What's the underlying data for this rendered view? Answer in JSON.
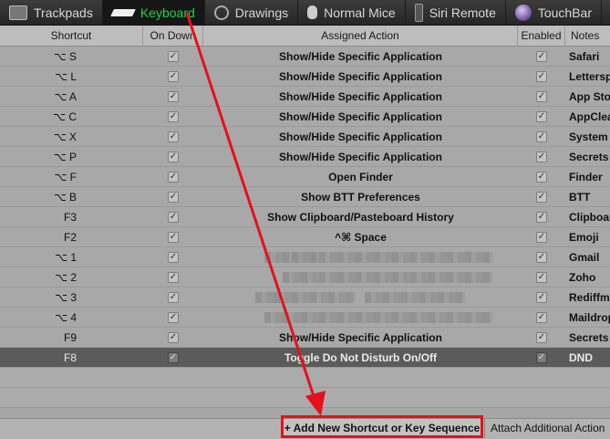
{
  "tabs": [
    {
      "label": "Trackpads",
      "icon": "trackpad-icon",
      "active": false
    },
    {
      "label": "Keyboard",
      "icon": "keyboard-icon",
      "active": true
    },
    {
      "label": "Drawings",
      "icon": "drawings-icon",
      "active": false
    },
    {
      "label": "Normal Mice",
      "icon": "mouse-icon",
      "active": false
    },
    {
      "label": "Siri Remote",
      "icon": "remote-icon",
      "active": false
    },
    {
      "label": "TouchBar",
      "icon": "touchbar-icon",
      "active": false
    }
  ],
  "columns": {
    "shortcut": "Shortcut",
    "ondown": "On Down",
    "action": "Assigned Action",
    "enabled": "Enabled",
    "notes": "Notes"
  },
  "rows": [
    {
      "shortcut": "⌥ S",
      "action": "Show/Hide Specific Application",
      "notes": "Safari"
    },
    {
      "shortcut": "⌥ L",
      "action": "Show/Hide Specific Application",
      "notes": "Letterspa"
    },
    {
      "shortcut": "⌥ A",
      "action": "Show/Hide Specific Application",
      "notes": "App Store"
    },
    {
      "shortcut": "⌥ C",
      "action": "Show/Hide Specific Application",
      "notes": "AppCleane"
    },
    {
      "shortcut": "⌥ X",
      "action": "Show/Hide Specific Application",
      "notes": "System"
    },
    {
      "shortcut": "⌥ P",
      "action": "Show/Hide Specific Application",
      "notes": "Secrets"
    },
    {
      "shortcut": "⌥ F",
      "action": "Open Finder",
      "notes": "Finder"
    },
    {
      "shortcut": "⌥ B",
      "action": "Show BTT Preferences",
      "notes": "BTT"
    },
    {
      "shortcut": "F3",
      "action": "Show Clipboard/Pasteboard History",
      "notes": "Clipboard"
    },
    {
      "shortcut": "F2",
      "action": "^⌘ Space",
      "notes": "Emoji"
    },
    {
      "shortcut": "⌥ 1",
      "action": "",
      "notes": "Gmail"
    },
    {
      "shortcut": "⌥ 2",
      "action": "",
      "notes": "Zoho"
    },
    {
      "shortcut": "⌥ 3",
      "action": "",
      "notes": "Rediffmail"
    },
    {
      "shortcut": "⌥ 4",
      "action": "",
      "notes": "Maildrop"
    },
    {
      "shortcut": "F9",
      "action": "Show/Hide Specific Application",
      "notes": "Secrets"
    },
    {
      "shortcut": "F8",
      "action": "Toggle Do Not Disturb On/Off",
      "notes": "DND",
      "selected": true
    }
  ],
  "checkmark": "✓",
  "footer": {
    "add_label": "+ Add New Shortcut or Key Sequence",
    "attach_label": "Attach Additional Action"
  },
  "colors": {
    "accent": "#22d04a",
    "annotation": "#e4111a",
    "selected_row": "#5b5b5b"
  }
}
